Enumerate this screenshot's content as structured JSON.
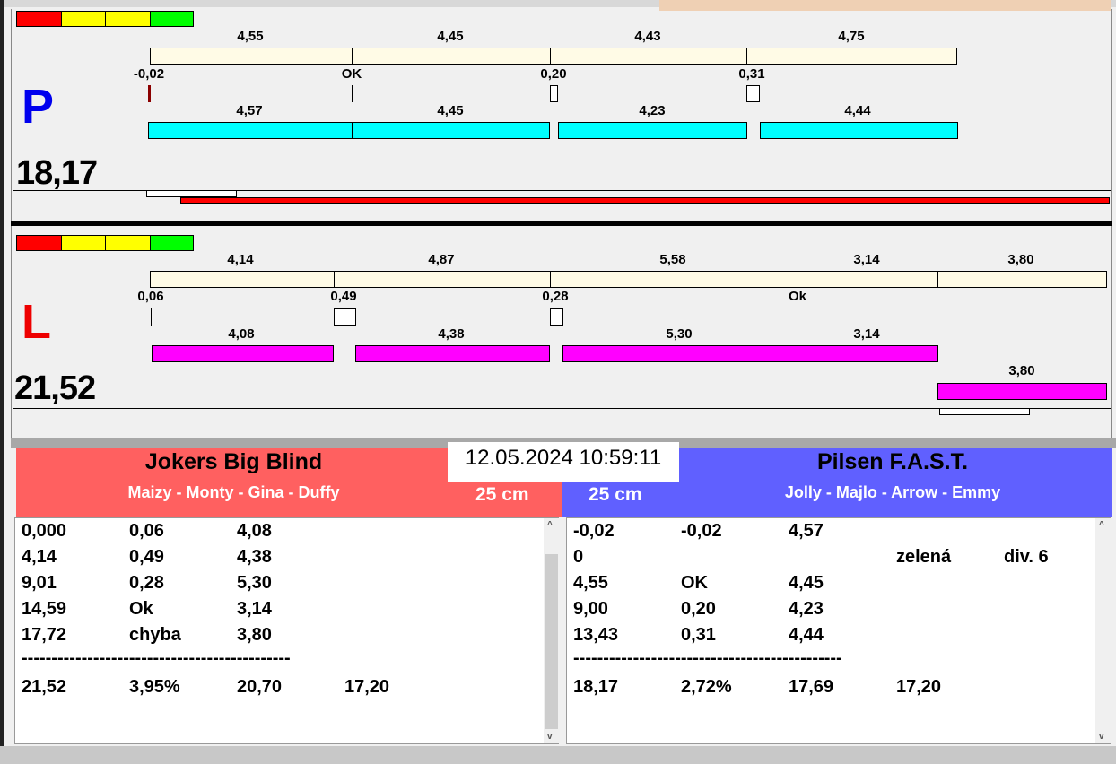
{
  "date_time": "12.05.2024 10:59:11",
  "status_colors": [
    "#ff0000",
    "#ffff00",
    "#ffff00",
    "#00ff00"
  ],
  "P": {
    "letter": "P",
    "total": "18,17",
    "top_labels": [
      "4,55",
      "4,45",
      "4,43",
      "4,75"
    ],
    "mid_labels": [
      "-0,02",
      "OK",
      "0,20",
      "0,31"
    ],
    "bar_labels": [
      "4,57",
      "4,45",
      "4,23",
      "4,44"
    ]
  },
  "L": {
    "letter": "L",
    "total": "21,52",
    "top_labels": [
      "4,14",
      "4,87",
      "5,58",
      "3,14",
      "3,80"
    ],
    "mid_labels": [
      "0,06",
      "0,49",
      "0,28",
      "Ok"
    ],
    "bar_labels": [
      "4,08",
      "4,38",
      "5,30",
      "3,14",
      "3,80"
    ]
  },
  "left_team": {
    "name": "Jokers Big Blind",
    "members": "Maizy - Monty - Gina - Duffy",
    "size": "25 cm",
    "rows": [
      [
        "0,000",
        "0,06",
        "4,08",
        ""
      ],
      [
        "4,14",
        "0,49",
        "4,38",
        ""
      ],
      [
        "9,01",
        "0,28",
        "5,30",
        ""
      ],
      [
        "14,59",
        "Ok",
        "3,14",
        ""
      ],
      [
        "17,72",
        "chyba",
        "3,80",
        ""
      ]
    ],
    "separator": "---------------------------------------------",
    "summary": [
      "21,52",
      "3,95%",
      "20,70",
      "17,20"
    ]
  },
  "right_team": {
    "name": "Pilsen F.A.S.T.",
    "members": "Jolly - Majlo - Arrow - Emmy",
    "size": "25 cm",
    "rows": [
      [
        "-0,02",
        "-0,02",
        "4,57",
        "",
        ""
      ],
      [
        "0",
        "",
        "",
        "zelená",
        "div. 6"
      ],
      [
        "4,55",
        "OK",
        "4,45",
        "",
        ""
      ],
      [
        "9,00",
        "0,20",
        "4,23",
        "",
        ""
      ],
      [
        "13,43",
        "0,31",
        "4,44",
        "",
        ""
      ]
    ],
    "separator": "---------------------------------------------",
    "summary": [
      "18,17",
      "2,72%",
      "17,69",
      "17,20"
    ]
  }
}
